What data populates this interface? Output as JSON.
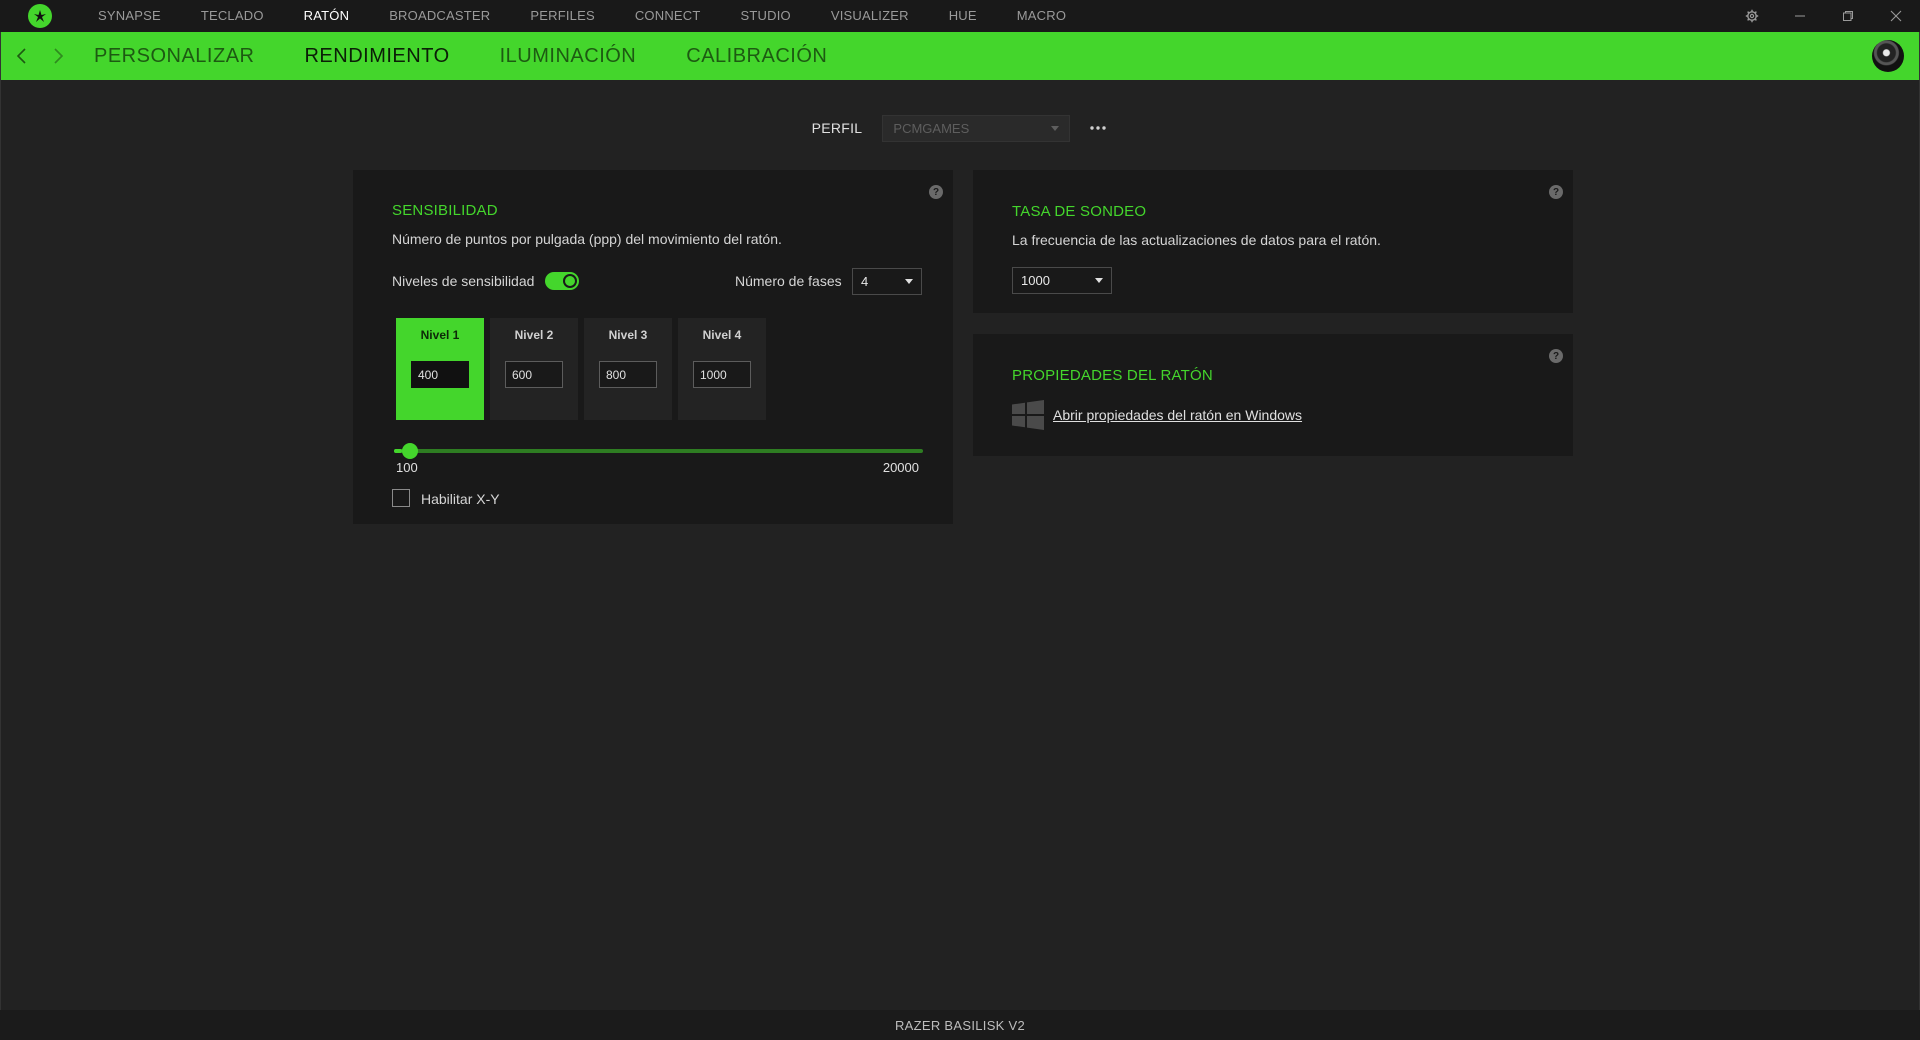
{
  "top_nav": {
    "items": [
      {
        "label": "SYNAPSE",
        "active": false
      },
      {
        "label": "TECLADO",
        "active": false
      },
      {
        "label": "RATÓN",
        "active": true
      },
      {
        "label": "BROADCASTER",
        "active": false
      },
      {
        "label": "PERFILES",
        "active": false
      },
      {
        "label": "CONNECT",
        "active": false
      },
      {
        "label": "STUDIO",
        "active": false
      },
      {
        "label": "VISUALIZER",
        "active": false
      },
      {
        "label": "HUE",
        "active": false
      },
      {
        "label": "MACRO",
        "active": false
      }
    ]
  },
  "sub_nav": {
    "tabs": [
      {
        "label": "PERSONALIZAR",
        "active": false
      },
      {
        "label": "RENDIMIENTO",
        "active": true
      },
      {
        "label": "ILUMINACIÓN",
        "active": false
      },
      {
        "label": "CALIBRACIÓN",
        "active": false
      }
    ]
  },
  "profile": {
    "label": "PERFIL",
    "value": "PCMGAMES"
  },
  "sensitivity": {
    "title": "SENSIBILIDAD",
    "description": "Número de puntos por pulgada (ppp) del movimiento del ratón.",
    "levels_label": "Niveles de sensibilidad",
    "levels_enabled": true,
    "stages_label": "Número de fases",
    "stages_value": "4",
    "levels": [
      {
        "name": "Nivel 1",
        "value": "400",
        "active": true
      },
      {
        "name": "Nivel 2",
        "value": "600",
        "active": false
      },
      {
        "name": "Nivel 3",
        "value": "800",
        "active": false
      },
      {
        "name": "Nivel 4",
        "value": "1000",
        "active": false
      }
    ],
    "slider_min": "100",
    "slider_max": "20000",
    "slider_value": 400,
    "xy_label": "Habilitar X-Y",
    "xy_enabled": false
  },
  "polling": {
    "title": "TASA DE SONDEO",
    "description": "La frecuencia de las actualizaciones de datos para el ratón.",
    "value": "1000"
  },
  "mouse_props": {
    "title": "PROPIEDADES DEL RATÓN",
    "link": "Abrir propiedades del ratón en Windows"
  },
  "footer": {
    "device": "RAZER BASILISK V2"
  },
  "colors": {
    "accent": "#44d62c",
    "background": "#222222",
    "panel": "#191919"
  },
  "icons": [
    "razer-logo-icon",
    "gear-icon",
    "minimize-icon",
    "maximize-icon",
    "close-icon",
    "chevron-left-icon",
    "chevron-right-icon",
    "chevron-down-icon",
    "more-icon",
    "help-icon",
    "windows-icon"
  ]
}
